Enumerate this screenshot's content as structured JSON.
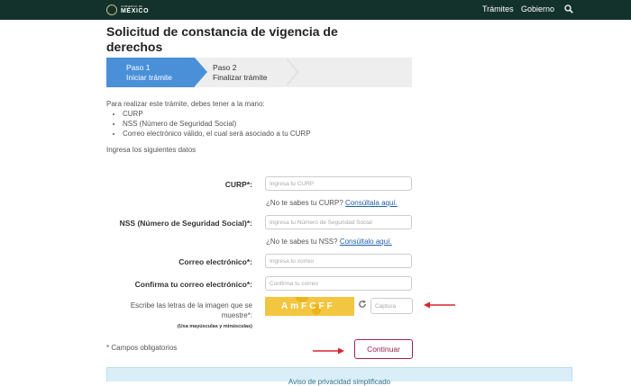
{
  "header": {
    "logo_small": "GOBIERNO DE",
    "logo_big": "MÉXICO",
    "nav": [
      {
        "label": "Trámites"
      },
      {
        "label": "Gobierno"
      }
    ],
    "search_icon": "search-icon"
  },
  "page": {
    "title": "Solicitud de constancia de vigencia de derechos"
  },
  "steps": [
    {
      "number": "Paso 1",
      "label": "Iniciar trámite",
      "active": true
    },
    {
      "number": "Paso 2",
      "label": "Finalizar trámite",
      "active": false
    }
  ],
  "intro": {
    "text": "Para realizar este trámite, debes tener a la mano:",
    "requirements": [
      "CURP",
      "NSS (Número de Seguridad Social)",
      "Correo electrónico válido, el cual será asociado a tu CURP"
    ],
    "prompt": "Ingresa los siguientes datos"
  },
  "form": {
    "curp": {
      "label": "CURP*:",
      "placeholder": "Ingresa tu CURP",
      "help_text": "¿No te sabes tu CURP? ",
      "help_link": "Consúltala aquí."
    },
    "nss": {
      "label": "NSS (Número de Seguridad Social)*:",
      "placeholder": "Ingresa tu Número de Seguridad Social",
      "help_text": "¿No te sabes tu NSS? ",
      "help_link": "Consúltalo aquí."
    },
    "email": {
      "label": "Correo electrónico*:",
      "placeholder": "Ingresa tu correo"
    },
    "email_confirm": {
      "label": "Confirma tu correo electrónico*:",
      "placeholder": "Confirma tu correo"
    },
    "captcha": {
      "label": "Escribe las letras de la imagen que se muestre*:",
      "label_sub": "(Usa mayúsculas y minúsculas)",
      "image_text": "AmFCFF",
      "placeholder": "Captura",
      "refresh_icon": "refresh-icon"
    },
    "required_note": "* Campos obligatorios",
    "submit_label": "Continuar"
  },
  "privacy": {
    "title": "Aviso de privacidad simplificado"
  },
  "colors": {
    "header_bg": "#13322b",
    "step_active": "#4a90d9",
    "button": "#9d2449",
    "annotation_arrow": "#d9232d",
    "captcha_bg": "#f2c640",
    "privacy_bg": "#d9eef7"
  }
}
